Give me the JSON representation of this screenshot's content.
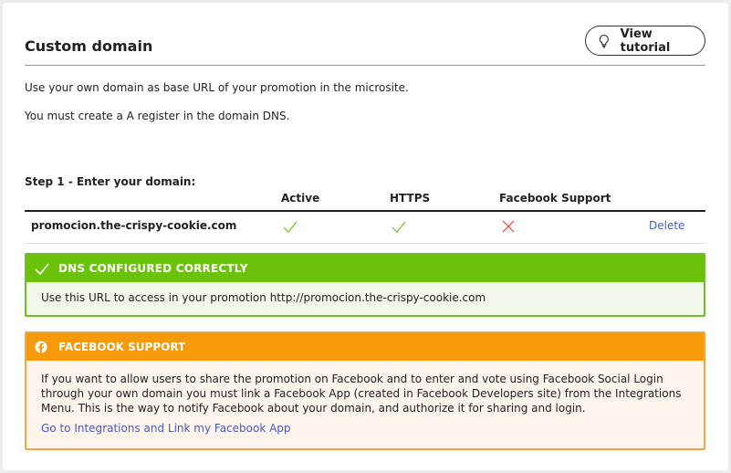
{
  "header": {
    "title": "Custom domain",
    "tutorial_label": "View tutorial"
  },
  "intro": {
    "line1": "Use your own domain as base URL of your promotion in the microsite.",
    "line2": "You must create a A register in the domain DNS."
  },
  "step": {
    "label": "Step 1 - Enter your domain:",
    "columns": [
      "Active",
      "HTTPS",
      "Facebook Support"
    ],
    "row": {
      "domain": "promocion.the-crispy-cookie.com",
      "active": "check-icon",
      "https": "check-icon",
      "facebook_support": "cross-icon",
      "action": "Delete"
    }
  },
  "dns_box": {
    "title": "DNS CONFIGURED CORRECTLY",
    "message": "Use this URL to access in your promotion http://promocion.the-crispy-cookie.com",
    "color": "#6cc20b"
  },
  "facebook_box": {
    "title": "FACEBOOK SUPPORT",
    "message": "If you want to allow users to share the promotion on Facebook and to enter and vote using Facebook Social Login through your own domain you must link a Facebook App (created in Facebook Developers site) from the Integrations Menu. This is the way to notify Facebook about your domain, and authorize it for sharing and login.",
    "link": "Go to Integrations and Link my Facebook App",
    "color": "#f69a0c"
  },
  "colors": {
    "link": "#4a5ab8",
    "check": "#6cc20b",
    "cross": "#e0433b"
  }
}
